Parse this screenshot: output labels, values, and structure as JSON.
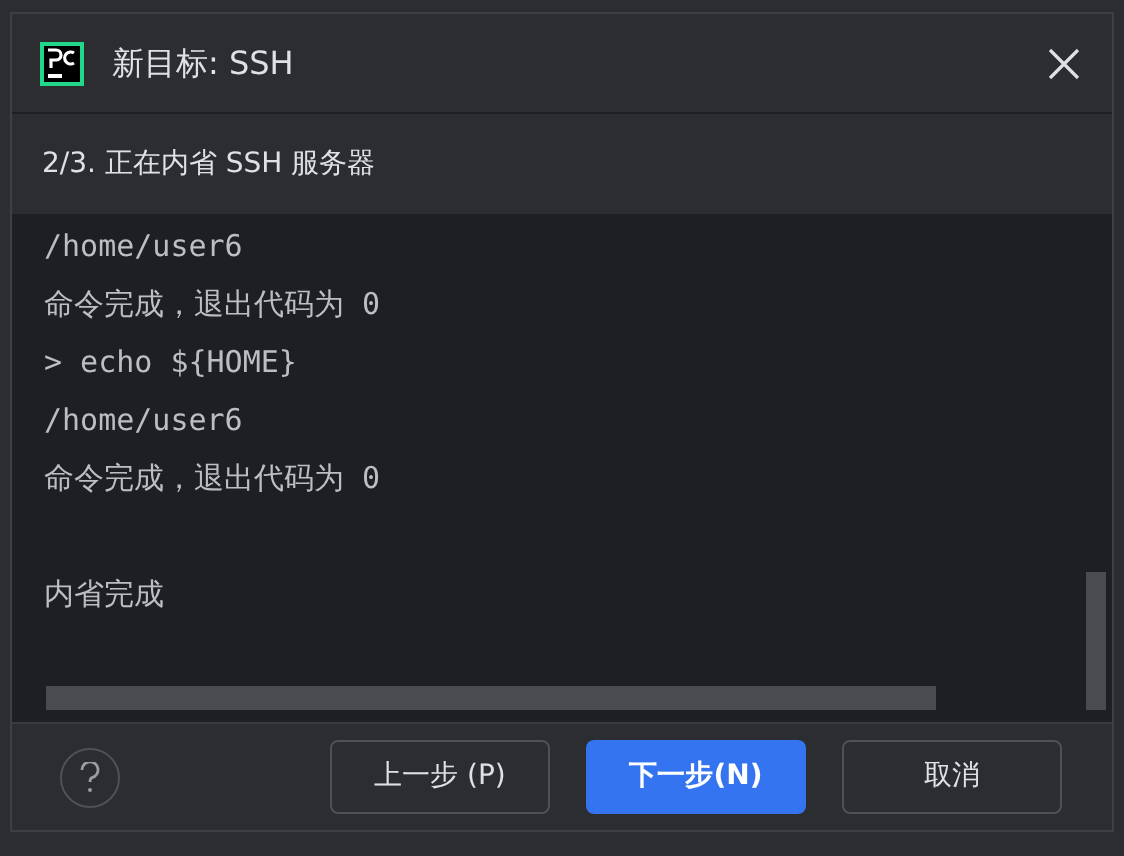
{
  "window": {
    "title": "新目标: SSH"
  },
  "step": "2/3. 正在内省 SSH 服务器",
  "log": {
    "lines": [
      "/home/user6",
      "命令完成，退出代码为 0",
      "> echo ${HOME}",
      "/home/user6",
      "命令完成，退出代码为 0"
    ],
    "result": "内省完成"
  },
  "buttons": [
    {
      "label": "上一步 (P)",
      "primary": false
    },
    {
      "label": "下一步(N)",
      "primary": true
    },
    {
      "label": "取消",
      "primary": false
    }
  ]
}
